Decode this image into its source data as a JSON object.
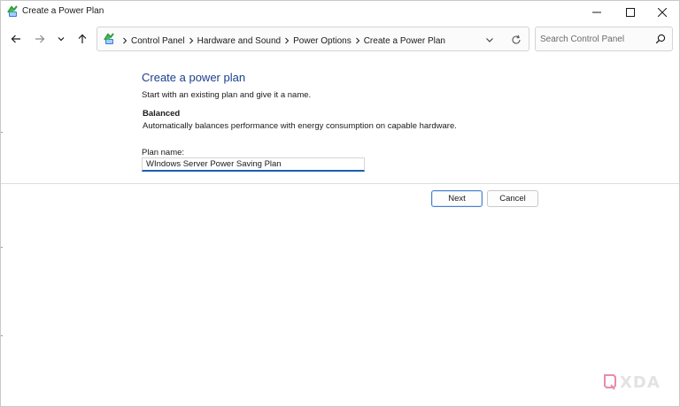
{
  "window": {
    "title": "Create a Power Plan",
    "controls": {
      "minimize_icon": "minimize-icon",
      "maximize_icon": "maximize-icon",
      "close_icon": "close-icon"
    }
  },
  "navigation": {
    "back_icon": "arrow-left-icon",
    "forward_icon": "arrow-right-icon",
    "recent_icon": "chevron-down-icon",
    "up_icon": "arrow-up-icon"
  },
  "address_bar": {
    "location_icon": "control-panel-icon",
    "breadcrumbs": [
      "Control Panel",
      "Hardware and Sound",
      "Power Options",
      "Create a Power Plan"
    ],
    "dropdown_icon": "chevron-down-icon",
    "refresh_icon": "refresh-icon"
  },
  "search": {
    "placeholder": "Search Control Panel",
    "value": "",
    "icon": "search-icon"
  },
  "content": {
    "heading": "Create a power plan",
    "intro": "Start with an existing plan and give it a name.",
    "selected_plan": {
      "name": "Balanced",
      "description": "Automatically balances performance with energy consumption on capable hardware."
    },
    "plan_name_label": "Plan name:",
    "plan_name_value": "WIndows Server Power Saving Plan"
  },
  "buttons": {
    "next": "Next",
    "cancel": "Cancel"
  },
  "watermark": {
    "text": "XDA"
  },
  "colors": {
    "heading": "#1c3f8f",
    "focus_accent": "#1a5fb4",
    "default_button_border": "#4a7fd0"
  }
}
